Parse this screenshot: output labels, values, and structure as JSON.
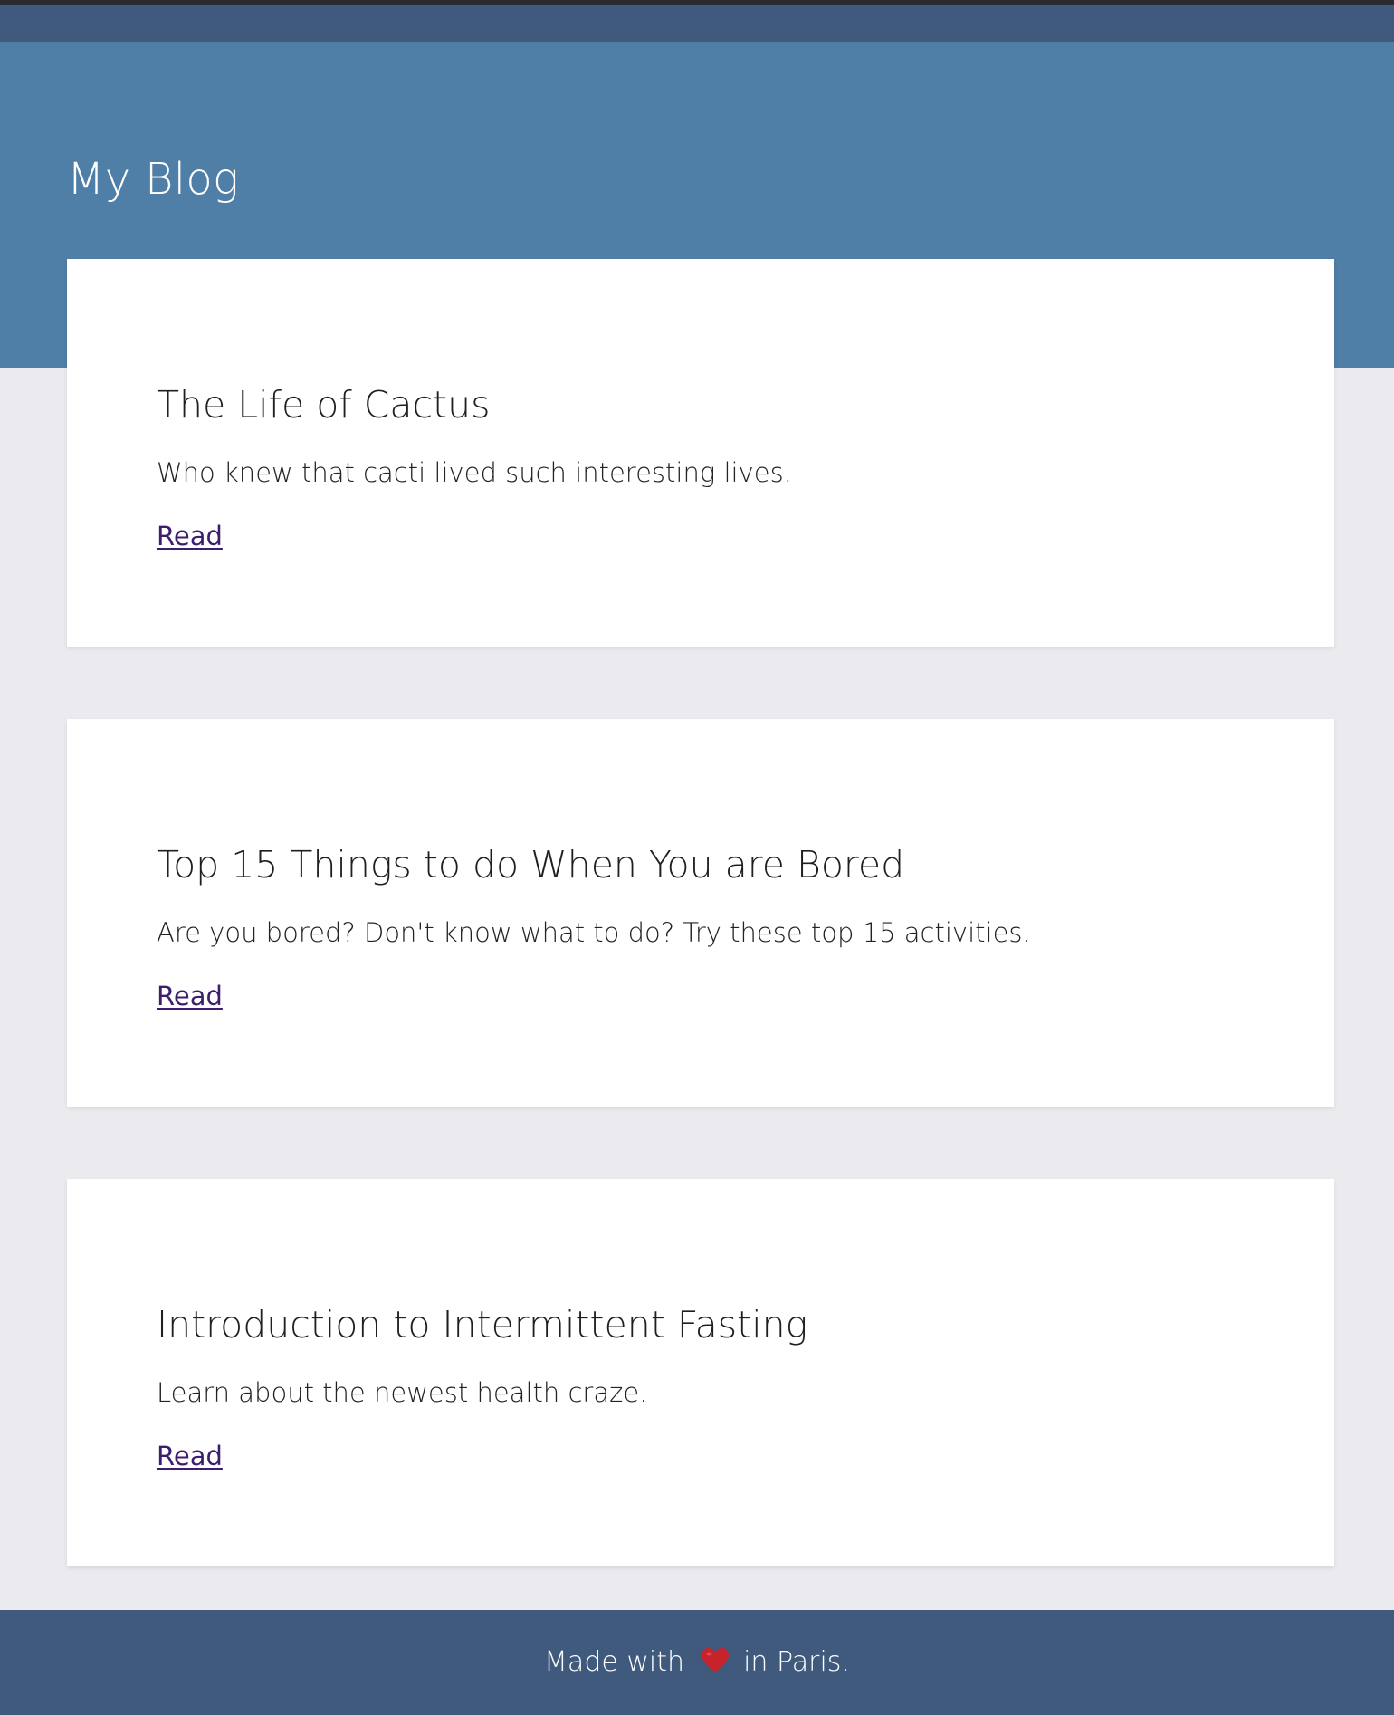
{
  "header": {
    "site_title": "My Blog"
  },
  "posts": [
    {
      "title": "The Life of Cactus",
      "excerpt": "Who knew that cacti lived such interesting lives.",
      "link_label": "Read"
    },
    {
      "title": "Top 15 Things to do When You are Bored",
      "excerpt": "Are you bored? Don't know what to do? Try these top 15 activities.",
      "link_label": "Read"
    },
    {
      "title": "Introduction to Intermittent Fasting",
      "excerpt": "Learn about the newest health craze.",
      "link_label": "Read"
    }
  ],
  "footer": {
    "prefix": "Made with",
    "icon": "heart-icon",
    "suffix": "in Paris."
  },
  "colors": {
    "top_bar": "#3f5a7d",
    "hero": "#4f7ea6",
    "page_background": "#ebebef",
    "card_background": "#ffffff",
    "link": "#3c1d6e",
    "heart": "#c8222a"
  }
}
